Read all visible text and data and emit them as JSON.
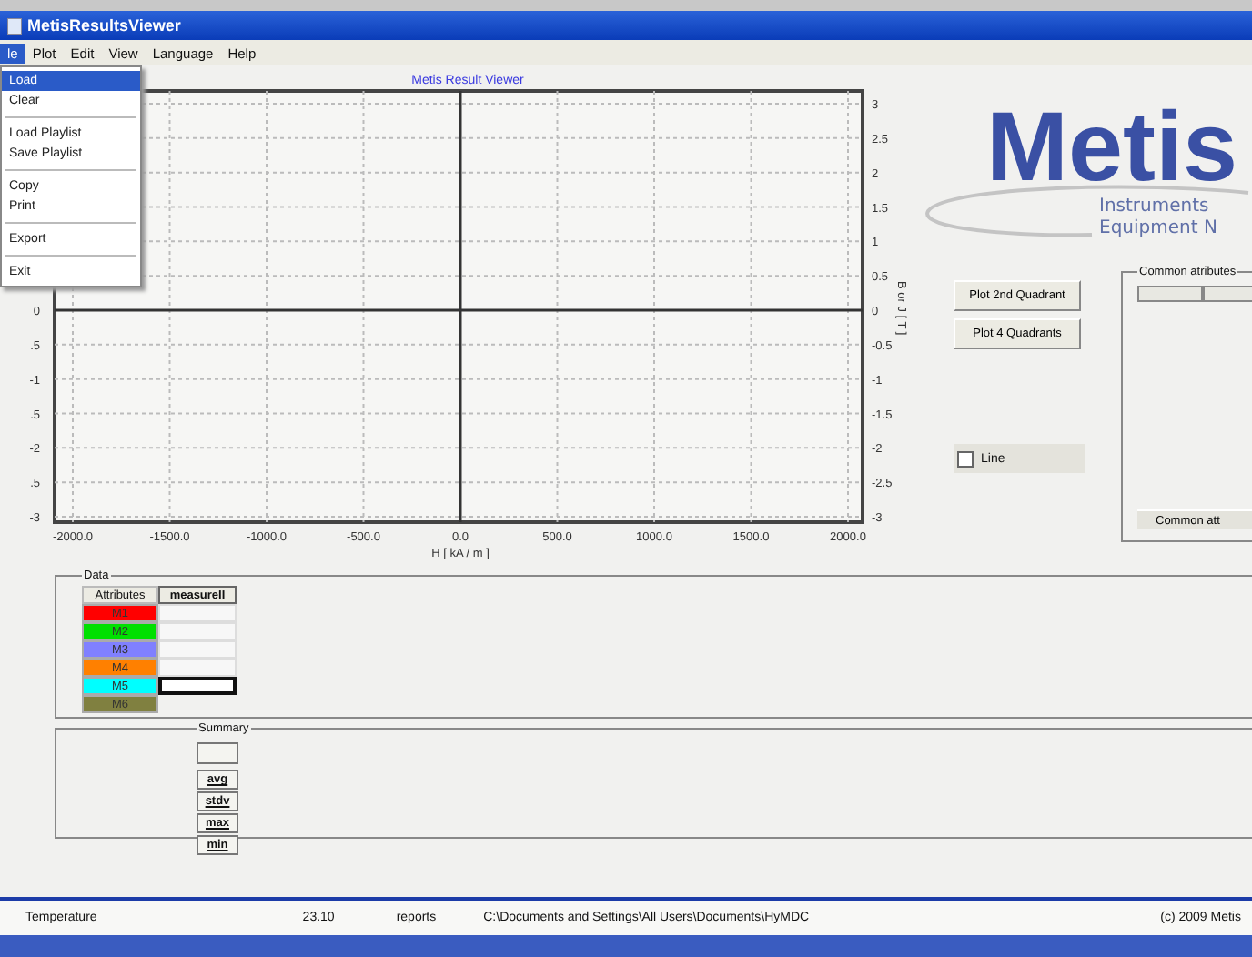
{
  "window": {
    "title": "MetisResultsViewer"
  },
  "menu_bar": [
    {
      "label": "le",
      "selected": true
    },
    {
      "label": "Plot",
      "selected": false
    },
    {
      "label": "Edit",
      "selected": false
    },
    {
      "label": "View",
      "selected": false
    },
    {
      "label": "Language",
      "selected": false
    },
    {
      "label": "Help",
      "selected": false
    }
  ],
  "file_menu": [
    {
      "kind": "item",
      "label": "Load",
      "selected": true
    },
    {
      "kind": "item",
      "label": "Clear",
      "selected": false
    },
    {
      "kind": "separator"
    },
    {
      "kind": "item",
      "label": "Load Playlist",
      "selected": false
    },
    {
      "kind": "item",
      "label": "Save Playlist",
      "selected": false
    },
    {
      "kind": "separator"
    },
    {
      "kind": "item",
      "label": "Copy",
      "selected": false
    },
    {
      "kind": "item",
      "label": "Print",
      "selected": false
    },
    {
      "kind": "separator"
    },
    {
      "kind": "item",
      "label": "Export",
      "selected": false
    },
    {
      "kind": "separator"
    },
    {
      "kind": "item",
      "label": "Exit",
      "selected": false
    }
  ],
  "plot": {
    "left_tick_labels": [
      "0",
      ".5",
      "-1",
      ".5",
      "-2",
      ".5",
      "-3"
    ],
    "chart_data": {
      "type": "line",
      "grid": true,
      "title": "Metis Result Viewer",
      "xlabel": "H [ kA / m ]",
      "ylabel": "B or J [ T ]",
      "xlim": [
        -2000,
        2000
      ],
      "ylim": [
        -3,
        3
      ],
      "xticks": [
        {
          "value": -2000,
          "label": "-2000.0"
        },
        {
          "value": -1500,
          "label": "-1500.0"
        },
        {
          "value": -1000,
          "label": "-1000.0"
        },
        {
          "value": -500,
          "label": "-500.0"
        },
        {
          "value": 0,
          "label": "0.0"
        },
        {
          "value": 500,
          "label": "500.0"
        },
        {
          "value": 1000,
          "label": "1000.0"
        },
        {
          "value": 1500,
          "label": "1500.0"
        },
        {
          "value": 2000,
          "label": "2000.0"
        }
      ],
      "yticks": [
        -3,
        -2.5,
        -2,
        -1.5,
        -1,
        -0.5,
        0,
        0.5,
        1,
        1.5,
        2,
        2.5,
        3
      ]
    }
  },
  "logo": {
    "name": "Metis",
    "line_1": "Instruments",
    "line_2": "Equipment N"
  },
  "buttons": [
    "Plot 2nd Quadrant",
    "Plot 4 Quadrants"
  ],
  "line_checkbox": {
    "label": "Line",
    "checked": false
  },
  "common_attributes": {
    "title": "Common atributes",
    "button": "Common att"
  },
  "data": {
    "title": "Data",
    "header": "Attributes",
    "column": "measureII",
    "rows": [
      {
        "label": "M1",
        "color": "#ff0000",
        "selected": false
      },
      {
        "label": "M2",
        "color": "#00e000",
        "selected": false
      },
      {
        "label": "M3",
        "color": "#8080ff",
        "selected": false
      },
      {
        "label": "M4",
        "color": "#ff8000",
        "selected": false
      },
      {
        "label": "M5",
        "color": "#00ffff",
        "selected": true
      },
      {
        "label": "M6",
        "color": "#808040",
        "selected": false
      }
    ]
  },
  "summary": {
    "title": "Summary",
    "rows": [
      "avg",
      "stdv",
      "max",
      "min"
    ]
  },
  "status_bar": {
    "label": "Temperature",
    "value": "23.10",
    "section": "reports",
    "path": "C:\\Documents and Settings\\All Users\\Documents\\HyMDC",
    "copyright": "(c) 2009 Metis"
  }
}
